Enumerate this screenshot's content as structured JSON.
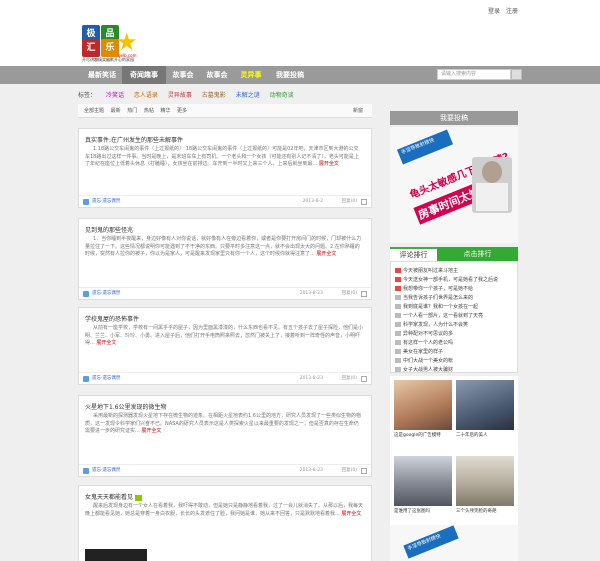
{
  "top": {
    "login": "登录",
    "register": "注册"
  },
  "logo": {
    "c1": "极",
    "c2": "品",
    "c3": "汇",
    "c4": "乐",
    "tagline": "开尽讲趣搞笑幽默开心的家园",
    "url": "gelb.com"
  },
  "nav": {
    "items": [
      "最新笑话",
      "奇闻趣事",
      "故事会",
      "故事会",
      "灵异事",
      "我要投稿"
    ],
    "search_placeholder": "请输入搜索内容"
  },
  "tags": {
    "label": "标签：",
    "items": [
      "冷笑话",
      "恋人语录",
      "灵异故事",
      "古墓鬼影",
      "未解之谜",
      "动物奇谈"
    ]
  },
  "filter": {
    "items": [
      "全部主题",
      "最新",
      "热门",
      "热帖",
      "精华",
      "更多"
    ],
    "newest": "新窗"
  },
  "posts": [
    {
      "title": "真实事件:在广州发生的那些未解事件",
      "body": "1.18路公交车闹鬼的事件（上过报纸的） 18路公交车闹鬼的事件（上过报纸的）可能是02年吧，天津市区到大港的公交车18路出过这样一件事。当时是晚上，是末班车车上有司机、一个老头和一个女孩（可能还有别人记不清了），老头可能是上了年纪在座位上低着头休息（打瞌睡），女孩坐在前排边。车开到一半时又上来三个人，上来后就坐到最...",
      "more": "展开全文",
      "author": "遗忘·遗忘偶然",
      "date": "2013-8-2",
      "reply": "回复(0)"
    },
    {
      "title": "见到鬼的那些怪兆",
      "body": "1．当你睡到半夜醒来，身边好像有人对你说话，就好像有人在旁边看着你，或者是你要打开房间门的时候，门却被什么力量拉住了一下。这些情况都说明你可能遇到了不干净的东西。只要平时多注意这一点，就不会出现太大的问题。2.在你熟睡的时候，突然有人拉你的被子，你以为是家人，可是醒来发现家里只有你一个人，这个时候你就得注意了...",
      "more": "展开全文",
      "author": "遗忘·遗忘偶然",
      "date": "2013-8-23",
      "reply": "回复(0)"
    },
    {
      "title": "学校鬼屋的恐怖事件",
      "body": "从前有一座学校，学校有一间黑乎乎的屋子，因为里面黑漆漆的，什么东西也看不见。有五个孩子去了屋子探险，他们是小明、兰兰、小军、玲玲、小勇。进入屋子后，他们打开手电筒照来照去，忽然门被关上了，接着听到一阵奇怪的声音，小明吓得...",
      "more": "展开全文",
      "author": "遗忘·遗忘偶然",
      "date": "2013-8-23",
      "reply": "回复(0)"
    },
    {
      "title": "火星地下1.6公里发现的微生物",
      "body": "采用最新的探测器发现火星地下存在微生物的迹象。在相距火星地表约1.6公里的地方，研究人员发现了一些类似生物的物质，这一发现令科学家们兴奋不已。NASA的研究人员表示这是人类探索火星以来最重要的发现之一，但是否真的存在生命仍需要进一步的研究证实...",
      "more": "展开全文",
      "author": "遗忘·遗忘偶然",
      "date": "2013-8-23",
      "reply": "回复(0)"
    },
    {
      "title": "女鬼天天都能看见",
      "body": "醒来后发现身边有一个女人在看着我，我吓得不敢动，但是她只是静静地看着我，过了一会儿就消失了。从那以后，我每天晚上都能看见她，她总是穿着一身白衣服，长长的头发遮住了脸，我问她是谁，她从来不回答，只是默默地看着我...",
      "more": "展开全文",
      "author": "",
      "date": "",
      "reply": ""
    }
  ],
  "sidebar": {
    "header": "我要投稿",
    "ad": {
      "l1": "手淫导致射精快",
      "l2": "龟头太敏感几下就射精?",
      "l3": "房事时间太短?"
    },
    "tabs": {
      "comment": "评论排行",
      "click": "点击排行"
    },
    "rank": [
      "今天被朋友叫过来斗地主",
      "今天送女神一部手机，可是她看了我之后说",
      "我想带你一个孩子，可是她不给",
      "当我告诉孩子们世界是怎么来的",
      "我到底是谁？我和一个女孩在一起",
      "一个人看一部片，这一看就到了天亮",
      "科学家发现，人为什么不会笑",
      "异种配对不可思议的多",
      "有这样一个人的老公吗",
      "美女在家里的样子",
      "中们大战一个美女的帐",
      "女子大战男人被大骗财"
    ],
    "thumbs": [
      "这是google的广告模特",
      "二十年后的美人",
      "是谁用了这张图吗",
      "三个头颅笑脸的奇葩"
    ]
  },
  "colors": {
    "nav_bg": "#9a9a9a",
    "nav_active": "#777777",
    "accent_red": "#cc0000",
    "tab_green": "#33aa33"
  }
}
